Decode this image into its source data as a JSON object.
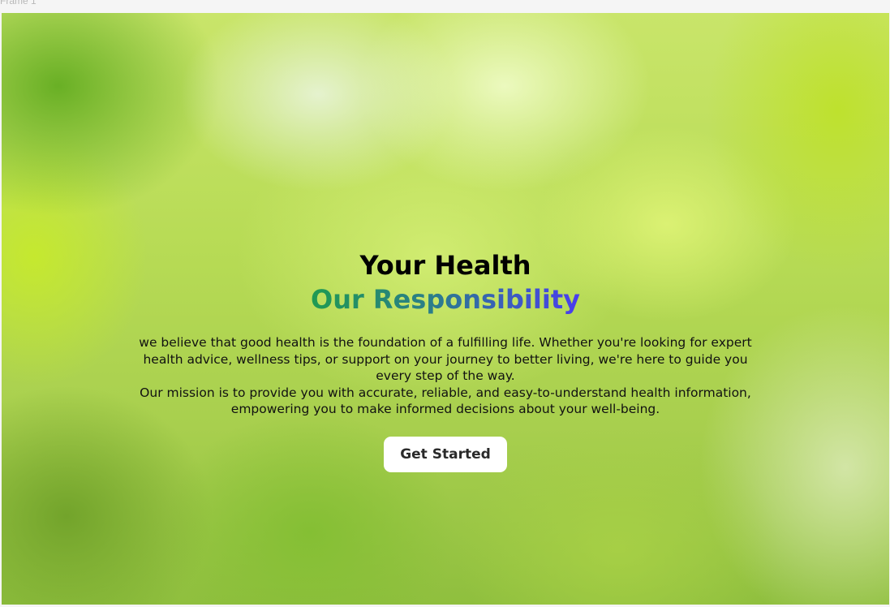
{
  "frame": {
    "label": "Frame 1"
  },
  "hero": {
    "title_line1": "Your Health",
    "title_line2": "Our Responsibility",
    "paragraph1": "we believe that good health is the foundation of a fulfilling life. Whether you're looking for expert health advice, wellness tips, or support on your journey to better living, we're here to guide you every step of the way.",
    "paragraph2": "Our mission is to provide you with accurate, reliable, and easy-to-understand health information, empowering you to make informed decisions about your well-being.",
    "cta_label": "Get Started"
  },
  "colors": {
    "title_gradient_start": "#1f9a52",
    "title_gradient_end": "#4a3df0",
    "button_bg": "#ffffff"
  }
}
